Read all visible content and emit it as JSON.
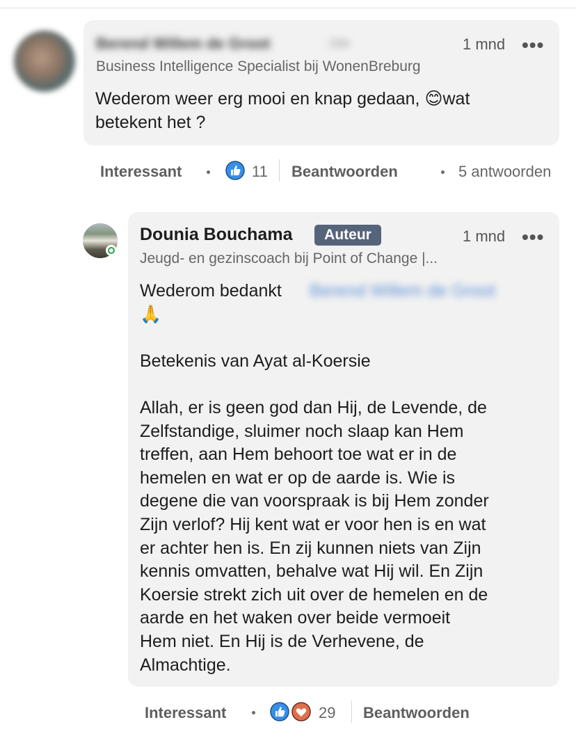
{
  "comment": {
    "author_name": "Berend Willem de Groot",
    "connection_degree": "· 2de",
    "time": "1 mnd",
    "more_label": "•••",
    "headline": "Business Intelligence Specialist bij WonenBreburg",
    "text_line1": "Wederom weer erg mooi en knap gedaan, ",
    "emoji": "😊",
    "text_line1b": "wat",
    "text_line2": "betekent het ?",
    "actions": {
      "like_label": "Interessant",
      "reaction_count": "11",
      "reply_label": "Beantwoorden",
      "replies_label": "5 antwoorden"
    }
  },
  "reply": {
    "author_name": "Dounia Bouchama",
    "badge": "Auteur",
    "time": "1 mnd",
    "more_label": "•••",
    "headline": "Jeugd- en gezinscoach bij Point of Change |...",
    "text_intro": "Wederom bedankt",
    "mention": "Berend Willem de Groot",
    "emoji": "🙏",
    "title_line": "Betekenis van Ayat al-Koersie",
    "paragraph": "Allah, er is geen god dan Hij, de Levende, de\nZelfstandige, sluimer noch slaap kan Hem\ntreffen, aan Hem behoort toe wat er in de\nhemelen en wat er op de aarde is. Wie is\ndegene die van voorspraak is bij Hem zonder\nZijn verlof? Hij kent wat er voor hen is en wat\ner achter hen is. En zij kunnen niets van Zijn\nkennis omvatten, behalve wat Hij wil. En Zijn\nKoersie strekt zich uit over de hemelen en de\naarde en het waken over beide vermoeit\nHem niet. En Hij is de Verhevene, de\nAlmachtige.",
    "actions": {
      "like_label": "Interessant",
      "reaction_count": "29",
      "reply_label": "Beantwoorden"
    }
  },
  "colors": {
    "bubble": "#f2f2f2",
    "badge": "#56647a",
    "like_blue": "#378fe9",
    "heart_orange": "#df704d",
    "online_green": "#2f9e4a"
  }
}
